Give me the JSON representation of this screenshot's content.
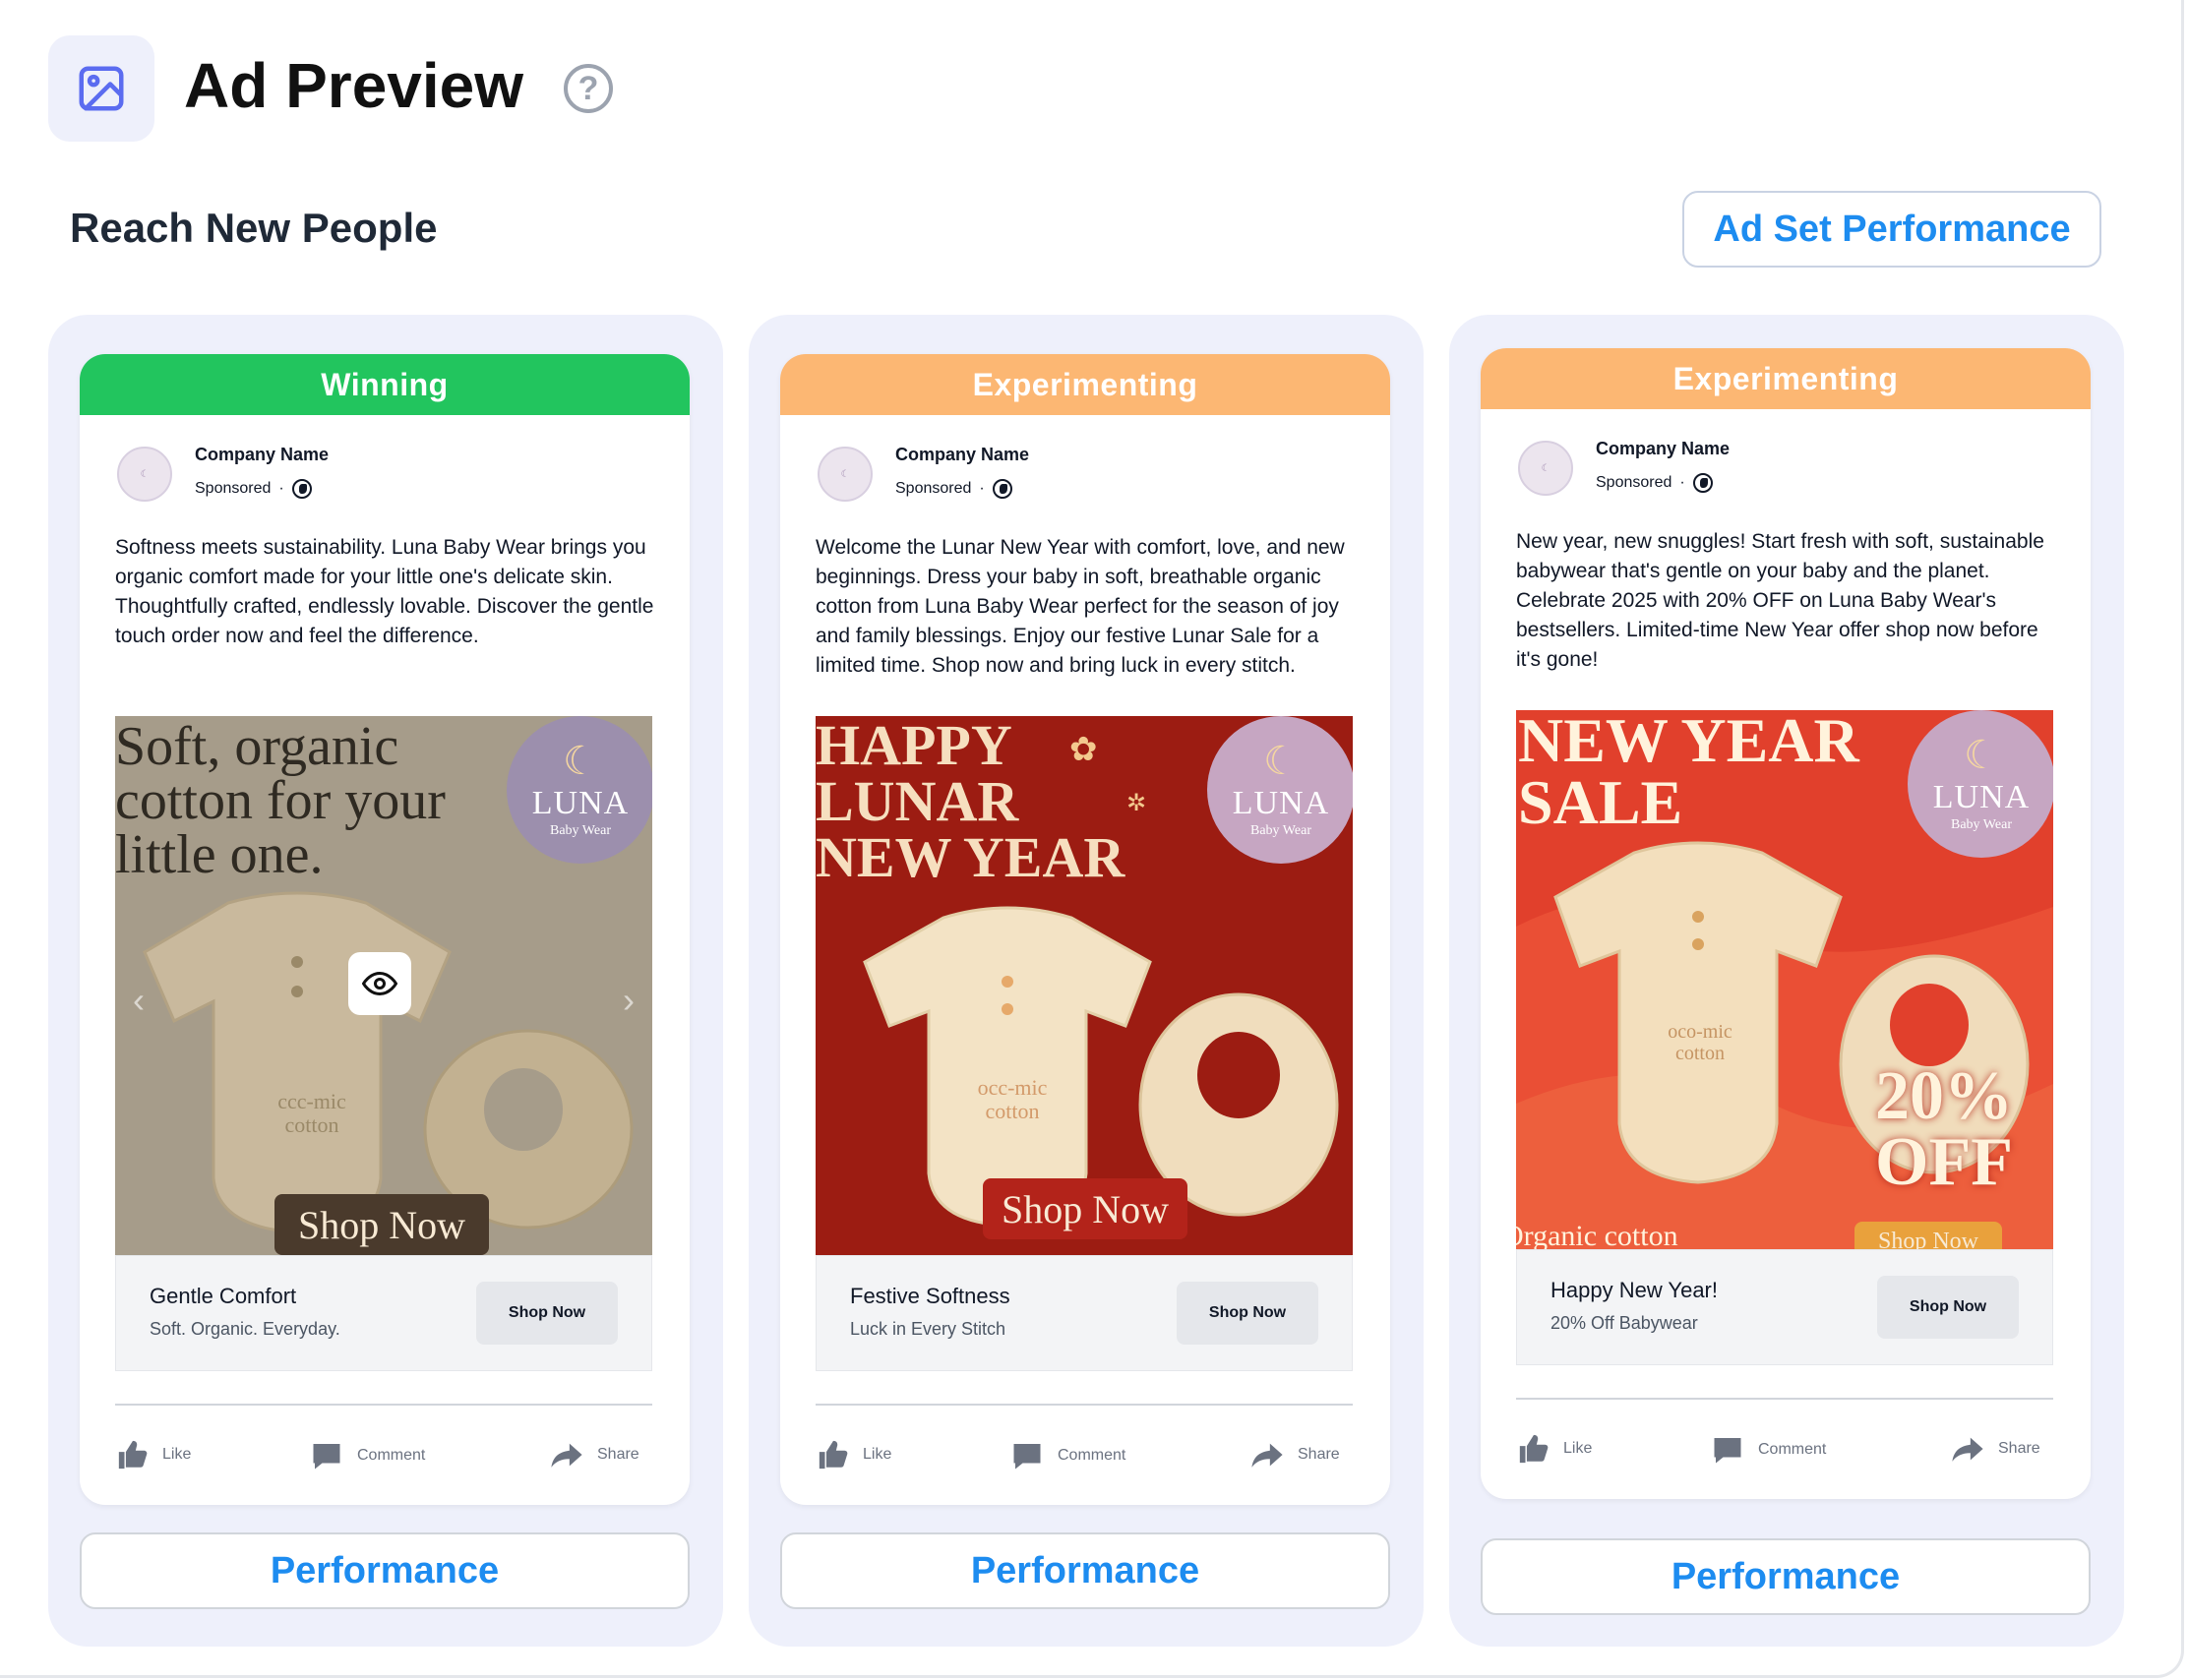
{
  "header": {
    "title": "Ad Preview",
    "help_symbol": "?",
    "icon": "image-icon"
  },
  "section": {
    "title": "Reach New People",
    "adset_button": "Ad Set Performance"
  },
  "colors": {
    "winning": "#22c55e",
    "experimenting": "#fcb773",
    "link_blue": "#1d8cf0",
    "column_bg": "#eef0fb"
  },
  "ads": [
    {
      "status": "Winning",
      "company": "Company Name",
      "sponsored": "Sponsored",
      "copy": "Softness meets sustainability. Luna Baby Wear brings you organic comfort made for your little one's delicate skin. Thoughtfully crafted, endlessly lovable. Discover the gentle touch order now and feel the difference.",
      "creative": {
        "headline": "Soft, organic\ncotton for your\nlittle one.",
        "brand": "LUNA",
        "brand_sub": "Baby Wear",
        "garment_text": "ccc-mic\ncotton",
        "shop_banner": "Shop Now"
      },
      "cta": {
        "title": "Gentle Comfort",
        "subtitle": "Soft. Organic. Everyday.",
        "button": "Shop Now"
      },
      "actions": {
        "like": "Like",
        "comment": "Comment",
        "share": "Share"
      },
      "performance": "Performance"
    },
    {
      "status": "Experimenting",
      "company": "Company Name",
      "sponsored": "Sponsored",
      "copy": "Welcome the Lunar New Year with comfort, love, and new beginnings. Dress your baby in soft, breathable organic cotton from Luna Baby Wear perfect for the season of joy and family blessings. Enjoy our festive Lunar Sale for a limited time. Shop now and bring luck in every stitch.",
      "creative": {
        "headline": "HAPPY\nLUNAR\nNEW YEAR",
        "brand": "LUNA",
        "brand_sub": "Baby Wear",
        "garment_text": "occ-mic\ncotton",
        "shop_banner": "Shop Now"
      },
      "cta": {
        "title": "Festive Softness",
        "subtitle": "Luck in Every Stitch",
        "button": "Shop Now"
      },
      "actions": {
        "like": "Like",
        "comment": "Comment",
        "share": "Share"
      },
      "performance": "Performance"
    },
    {
      "status": "Experimenting",
      "company": "Company Name",
      "sponsored": "Sponsored",
      "copy": "New year, new snuggles! Start fresh with soft, sustainable babywear that's gentle on your baby and the planet. Celebrate 2025 with 20% OFF on Luna Baby Wear's bestsellers. Limited-time New Year offer shop now before it's gone!",
      "creative": {
        "headline": "NEW YEAR\nSALE",
        "brand": "LUNA",
        "brand_sub": "Baby Wear",
        "garment_text": "oco-mic\ncotton",
        "discount": "20%\nOFF",
        "footer_text": "Organic cotton",
        "shop_banner": "Shop Now"
      },
      "cta": {
        "title": "Happy New Year!",
        "subtitle": "20% Off Babywear",
        "button": "Shop Now"
      },
      "actions": {
        "like": "Like",
        "comment": "Comment",
        "share": "Share"
      },
      "performance": "Performance"
    }
  ]
}
